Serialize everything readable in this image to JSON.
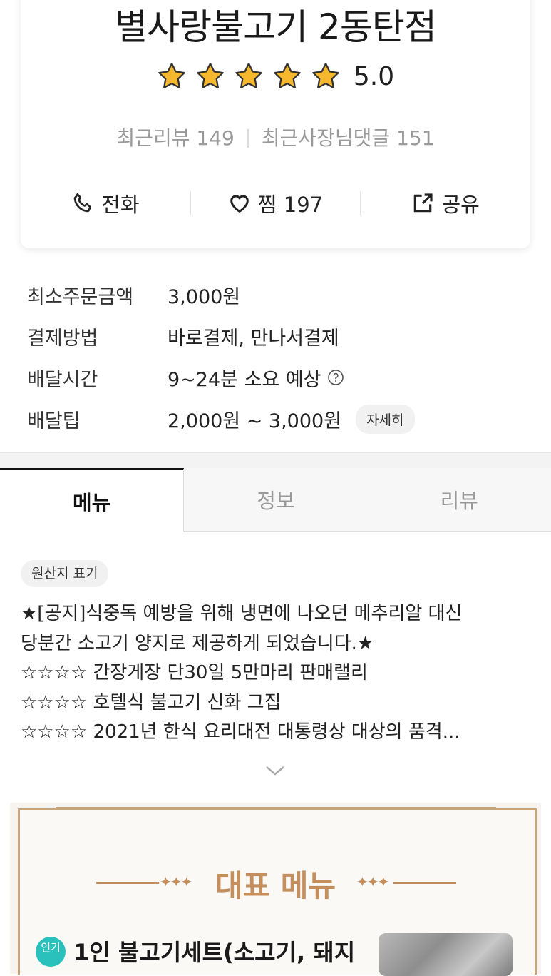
{
  "store": {
    "name": "별사랑불고기 2동탄점",
    "rating": "5.0",
    "rating_value": 5,
    "star_count": 5,
    "recent_reviews_label": "최근리뷰 149",
    "owner_replies_label": "최근사장님댓글 151"
  },
  "actions": {
    "call_label": "전화",
    "favorite_label": "찜",
    "favorite_count": "197",
    "share_label": "공유"
  },
  "info": {
    "min_order": {
      "label": "최소주문금액",
      "value": "3,000원"
    },
    "payment": {
      "label": "결제방법",
      "value": "바로결제, 만나서결제"
    },
    "delivery_time": {
      "label": "배달시간",
      "value": "9~24분 소요 예상"
    },
    "delivery_tip": {
      "label": "배달팁",
      "value": "2,000원 ~ 3,000원",
      "detail_button": "자세히"
    }
  },
  "tabs": [
    {
      "label": "메뉴",
      "active": true
    },
    {
      "label": "정보",
      "active": false
    },
    {
      "label": "리뷰",
      "active": false
    }
  ],
  "notice": {
    "origin_chip": "원산지 표기",
    "lines": [
      "★[공지]식중독 예방을 위해 냉면에 나오던 메추리알 대신",
      "당분간 소고기 양지로 제공하게 되었습니다.★",
      "☆☆☆☆ 간장게장 단30일 5만마리 판매랠리",
      "☆☆☆☆ 호텔식 불고기 신화 그집",
      "☆☆☆☆ 2021년 한식 요리대전 대통령상 대상의 품격..."
    ]
  },
  "featured": {
    "title": "대표 메뉴",
    "ornament_left": "✦✦✦",
    "ornament_right": "✦✦✦",
    "first_item": {
      "badge": "인기",
      "name": "1인 불고기세트(소고기, 돼지"
    }
  },
  "colors": {
    "star": "#f5b82e",
    "accent_gold": "#c48f5c",
    "badge_teal": "#2ac1bc"
  }
}
